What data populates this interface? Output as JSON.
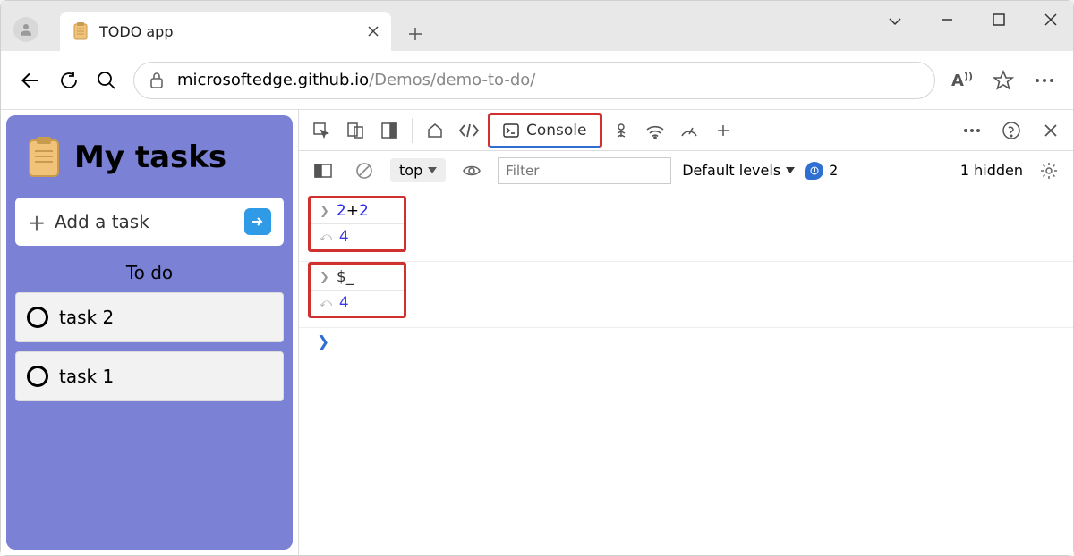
{
  "window": {
    "tab_title": "TODO app",
    "url_host": "microsoftedge.github.io",
    "url_path": "/Demos/demo-to-do/"
  },
  "app": {
    "title": "My tasks",
    "add_task_label": "Add a task",
    "section_label": "To do",
    "tasks": [
      "task 2",
      "task 1"
    ]
  },
  "devtools": {
    "active_tab": "Console",
    "context": "top",
    "filter_placeholder": "Filter",
    "levels_label": "Default levels",
    "issues_count": "2",
    "hidden_label": "1 hidden",
    "console": {
      "entries": [
        {
          "input_a": "2",
          "input_op": "+",
          "input_b": "2",
          "output": "4"
        },
        {
          "input_ident": "$_",
          "output": "4"
        }
      ]
    }
  }
}
